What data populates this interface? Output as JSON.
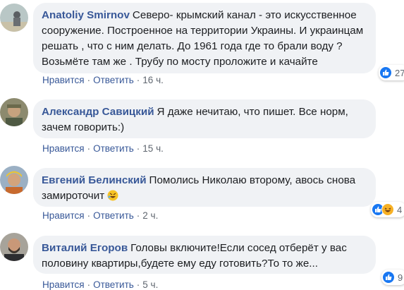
{
  "comments": [
    {
      "author": "Anatoliy Smirnov",
      "text": "Северо- крымский канал - это искусственное сооружение. Построенное на территории Украины. И украинцам решать , что с ним делать. До 1961 года где то брали воду ? Возьмёте там же . Трубу по мосту проложите и качайте",
      "like_label": "Нравится",
      "reply_label": "Ответить",
      "time": "16 ч.",
      "reaction_count": "27",
      "reactions": [
        "like-icon"
      ]
    },
    {
      "author": "Александр Савицкий",
      "text": "Я даже нечитаю, что пишет. Все норм, зачем говорить:)",
      "like_label": "Нравится",
      "reply_label": "Ответить",
      "time": "15 ч.",
      "reaction_count": "",
      "reactions": []
    },
    {
      "author": "Евгений Белинский",
      "text": "Помолись Николаю второму, авось снова замироточит",
      "emoji": "rofl-emoji",
      "like_label": "Нравится",
      "reply_label": "Ответить",
      "time": "2 ч.",
      "reaction_count": "4",
      "reactions": [
        "like-icon",
        "haha-icon"
      ]
    },
    {
      "author": "Виталий Егоров",
      "text": "Головы включите!Если сосед отберёт у вас половину квартиры,будете ему еду готовить?То то же...",
      "like_label": "Нравится",
      "reply_label": "Ответить",
      "time": "5 ч.",
      "reaction_count": "9",
      "reactions": [
        "like-icon"
      ]
    }
  ],
  "colors": {
    "author": "#385898",
    "bubble": "#f0f2f5",
    "like": "#1877f2",
    "haha": "#f7b125"
  }
}
